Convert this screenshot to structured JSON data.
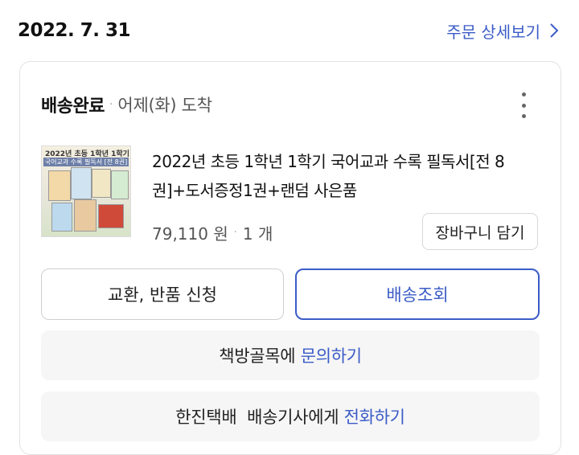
{
  "order": {
    "date": "2022. 7. 31",
    "detail_link": "주문 상세보기"
  },
  "delivery": {
    "status": "배송완료",
    "arrival": "어제(화) 도착"
  },
  "product": {
    "title": "2022년 초등 1학년 1학기 국어교과 수록 필독서[전 8권]+도서증정1권+랜덤 사은품",
    "price": "79,110 원",
    "quantity": "1 개",
    "cart_button": "장바구니 담기",
    "thumbnail_text_1": "2022년 초등 1학년 1학기",
    "thumbnail_text_2": "국어교과 수록 필독서 [전 8권]"
  },
  "actions": {
    "exchange_return": "교환, 반품 신청",
    "track_delivery": "배송조회"
  },
  "contacts": {
    "seller_name": "책방골목에",
    "seller_link": "문의하기",
    "courier_name": "한진택배  배송기사에게",
    "courier_link": "전화하기"
  },
  "colors": {
    "accent": "#3b5cc7",
    "card_border": "#e2e2e2",
    "contact_bg": "#f6f6f6"
  },
  "icons": {
    "detail_chevron": "chevron-right-icon",
    "menu": "more-vertical-icon"
  }
}
